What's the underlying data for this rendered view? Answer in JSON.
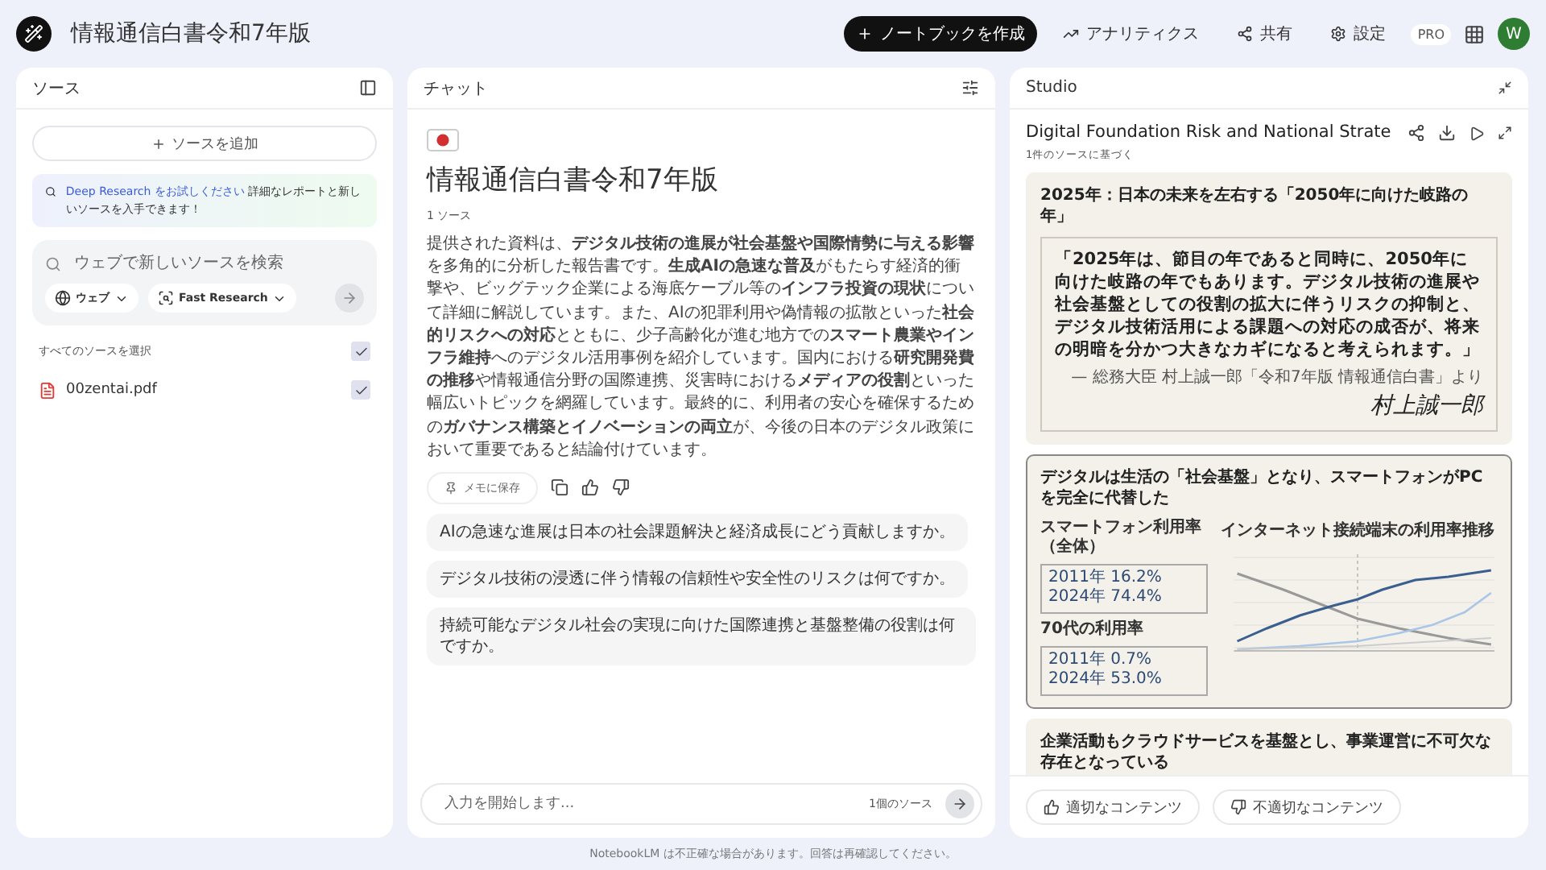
{
  "header": {
    "title": "情報通信白書令和7年版",
    "actions": [
      {
        "kind": "create",
        "label": "ノートブックを作成"
      },
      {
        "kind": "analytics",
        "label": "アナリティクス"
      },
      {
        "kind": "share",
        "label": "共有"
      },
      {
        "kind": "settings",
        "label": "設定"
      }
    ],
    "plan_badge": "PRO",
    "avatar_initial": "W"
  },
  "sources": {
    "title": "ソース",
    "add_button": "ソースを追加",
    "promo": {
      "link": "Deep Research をお試しください",
      "text": "詳細なレポートと新しいソースを入手できます！"
    },
    "search": {
      "placeholder": "ウェブで新しいソースを検索",
      "chips": [
        {
          "kind": "web",
          "label": "ウェブ"
        },
        {
          "kind": "research",
          "label": "Fast Research"
        }
      ]
    },
    "select_all": {
      "label": "すべてのソースを選択",
      "checked": true
    },
    "items": [
      {
        "name": "00zentai.pdf",
        "checked": true
      }
    ]
  },
  "chat": {
    "title": "チャット",
    "notebook_title": "情報通信白書令和7年版",
    "source_count": "1 ソース",
    "summary": "提供された資料は、**デジタル技術の進展が社会基盤や国際情勢に与える影響**を多角的に分析した報告書です。**生成AIの急速な普及**がもたらす経済的衝撃や、ビッグテック企業による海底ケーブル等の**インフラ投資の現状**について詳細に解説しています。また、AIの犯罪利用や偽情報の拡散といった**社会的リスクへの対応**とともに、少子高齢化が進む地方での**スマート農業やインフラ維持**へのデジタル活用事例を紹介しています。国内における**研究開発費の推移**や情報通信分野の国際連携、災害時における**メディアの役割**といった幅広いトピックを網羅しています。最終的に、利用者の安心を確保するための**ガバナンス構築とイノベーションの両立**が、今後の日本のデジタル政策において重要であると結論付けています。",
    "save_note": "メモに保存",
    "suggestions": [
      "AIの急速な進展は日本の社会課題解決と経済成長にどう貢献しますか。",
      "デジタル技術の浸透に伴う情報の信頼性や安全性のリスクは何ですか。",
      "持続可能なデジタル社会の実現に向けた国際連携と基盤整備の役割は何ですか。"
    ],
    "input": {
      "placeholder": "入力を開始します...",
      "source_count": "1個のソース"
    },
    "disclaimer": "NotebookLM は不正確な場合があります。回答は再確認してください。"
  },
  "studio": {
    "title": "Studio",
    "artifact_title": "Digital Foundation Risk and National Strate",
    "artifact_subtitle": "1件のソースに基づく",
    "slides": [
      {
        "kind": "quote",
        "title": "2025年：日本の未来を左右する「2050年に向けた岐路の年」",
        "quote": "「2025年は、節目の年であると同時に、2050年に向けた岐路の年でもあります。デジタル技術の進展や社会基盤としての役割の拡大に伴うリスクの抑制と、デジタル技術活用による課題への対応の成否が、将来の明暗を分かつ大きなカギになると考えられます。」",
        "attribution": "— 総務大臣 村上誠一郎「令和7年版 情報通信白書」より",
        "signature": "村上誠一郎"
      },
      {
        "kind": "chart",
        "title": "デジタルは生活の「社会基盤」となり、スマートフォンがPCを完全に代替した",
        "chart_title": "インターネット接続端末の利用率推移",
        "stats": [
          {
            "label": "スマートフォン利用率（全体）",
            "from": "2011年 16.2%",
            "to": "2024年 74.4%"
          },
          {
            "label": "70代の利用率",
            "from": "2011年 0.7%",
            "to": "2024年 53.0%"
          }
        ]
      },
      {
        "kind": "title",
        "title": "企業活動もクラウドサービスを基盤とし、事業運営に不可欠な存在となっている"
      }
    ],
    "feedback": [
      "適切なコンテンツ",
      "不適切なコンテンツ"
    ]
  }
}
